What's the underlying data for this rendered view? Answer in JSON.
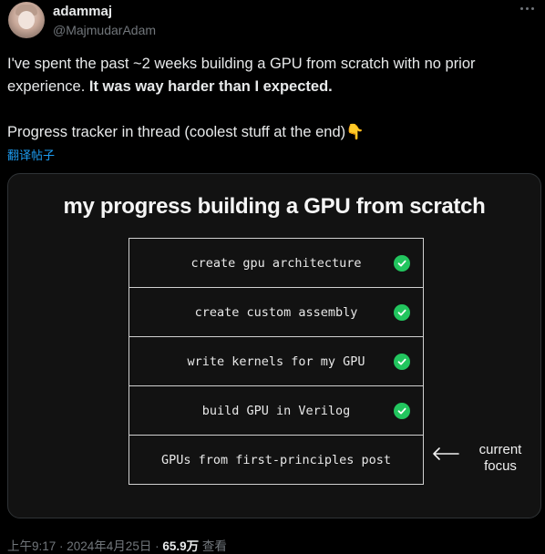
{
  "author": {
    "name": "adammaj",
    "handle": "@MajmudarAdam"
  },
  "tweet": {
    "line1_normal": "I've spent the past ~2 weeks building a GPU from scratch with no prior experience. ",
    "line1_bold": "It was way harder than I expected.",
    "line2": "Progress tracker in thread (coolest stuff at the end)👇",
    "translate_label": "翻译帖子"
  },
  "card": {
    "title": "my progress building a GPU from scratch",
    "rows": [
      {
        "label": "create gpu architecture",
        "done": true
      },
      {
        "label": "create custom assembly",
        "done": true
      },
      {
        "label": "write kernels for my GPU",
        "done": true
      },
      {
        "label": "build GPU in Verilog",
        "done": true
      },
      {
        "label": "GPUs from first-principles post",
        "done": false
      }
    ],
    "current_focus_line1": "current",
    "current_focus_line2": "focus",
    "check_color": "#22c55e"
  },
  "meta": {
    "timestamp": "上午9:17 · 2024年4月25日 · ",
    "views_count": "65.9万",
    "views_label": " 查看"
  },
  "icons": {
    "more": "more-icon",
    "check": "check-circle-icon",
    "arrow": "arrow-left-icon"
  }
}
